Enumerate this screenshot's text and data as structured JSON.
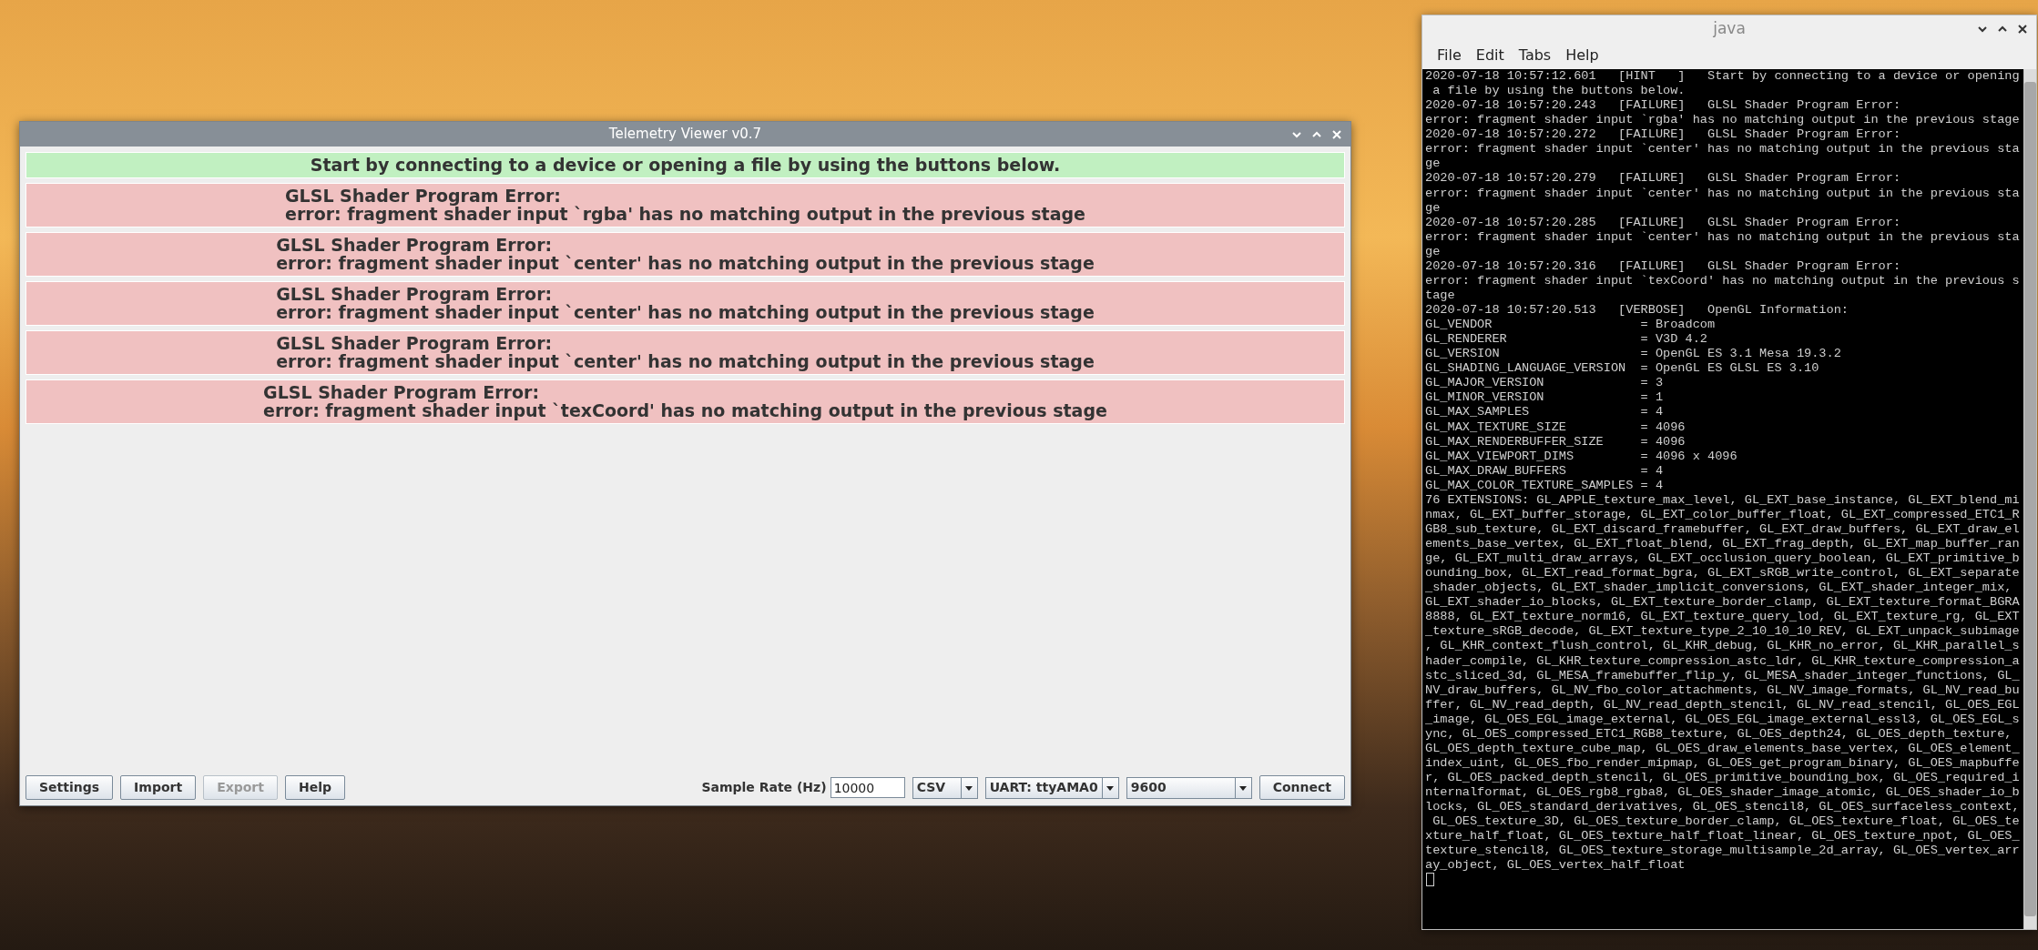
{
  "telemetry_window": {
    "title": "Telemetry Viewer v0.7",
    "messages": [
      {
        "kind": "hint",
        "lines": [
          "Start by connecting to a device or opening a file by using the buttons below."
        ]
      },
      {
        "kind": "failure",
        "lines": [
          "GLSL Shader Program Error:",
          "error: fragment shader input `rgba' has no matching output in the previous stage"
        ]
      },
      {
        "kind": "failure",
        "lines": [
          "GLSL Shader Program Error:",
          "error: fragment shader input `center' has no matching output in the previous stage"
        ]
      },
      {
        "kind": "failure",
        "lines": [
          "GLSL Shader Program Error:",
          "error: fragment shader input `center' has no matching output in the previous stage"
        ]
      },
      {
        "kind": "failure",
        "lines": [
          "GLSL Shader Program Error:",
          "error: fragment shader input `center' has no matching output in the previous stage"
        ]
      },
      {
        "kind": "failure",
        "lines": [
          "GLSL Shader Program Error:",
          "error: fragment shader input `texCoord' has no matching output in the previous stage"
        ]
      }
    ],
    "buttons": [
      {
        "label": "Settings",
        "disabled": false
      },
      {
        "label": "Import",
        "disabled": false
      },
      {
        "label": "Export",
        "disabled": true
      },
      {
        "label": "Help",
        "disabled": false
      }
    ],
    "sample_rate_label": "Sample Rate (Hz)",
    "sample_rate": "10000",
    "format": "CSV",
    "port": "UART: ttyAMA0",
    "baud": "9600",
    "connect": "Connect"
  },
  "terminal_window": {
    "title": "java",
    "menu": [
      "File",
      "Edit",
      "Tabs",
      "Help"
    ],
    "lines": [
      "2020-07-18 10:57:12.601   [HINT   ]   Start by connecting to a device or opening",
      " a file by using the buttons below.",
      "2020-07-18 10:57:20.243   [FAILURE]   GLSL Shader Program Error:",
      "error: fragment shader input `rgba' has no matching output in the previous stage",
      "2020-07-18 10:57:20.272   [FAILURE]   GLSL Shader Program Error:",
      "error: fragment shader input `center' has no matching output in the previous sta",
      "ge",
      "2020-07-18 10:57:20.279   [FAILURE]   GLSL Shader Program Error:",
      "error: fragment shader input `center' has no matching output in the previous sta",
      "ge",
      "2020-07-18 10:57:20.285   [FAILURE]   GLSL Shader Program Error:",
      "error: fragment shader input `center' has no matching output in the previous sta",
      "ge",
      "2020-07-18 10:57:20.316   [FAILURE]   GLSL Shader Program Error:",
      "error: fragment shader input `texCoord' has no matching output in the previous s",
      "tage",
      "2020-07-18 10:57:20.513   [VERBOSE]   OpenGL Information:",
      "GL_VENDOR                    = Broadcom",
      "GL_RENDERER                  = V3D 4.2",
      "GL_VERSION                   = OpenGL ES 3.1 Mesa 19.3.2",
      "GL_SHADING_LANGUAGE_VERSION  = OpenGL ES GLSL ES 3.10",
      "GL_MAJOR_VERSION             = 3",
      "GL_MINOR_VERSION             = 1",
      "GL_MAX_SAMPLES               = 4",
      "GL_MAX_TEXTURE_SIZE          = 4096",
      "GL_MAX_RENDERBUFFER_SIZE     = 4096",
      "GL_MAX_VIEWPORT_DIMS         = 4096 x 4096",
      "GL_MAX_DRAW_BUFFERS          = 4",
      "GL_MAX_COLOR_TEXTURE_SAMPLES = 4",
      "76 EXTENSIONS: GL_APPLE_texture_max_level, GL_EXT_base_instance, GL_EXT_blend_mi",
      "nmax, GL_EXT_buffer_storage, GL_EXT_color_buffer_float, GL_EXT_compressed_ETC1_R",
      "GB8_sub_texture, GL_EXT_discard_framebuffer, GL_EXT_draw_buffers, GL_EXT_draw_el",
      "ements_base_vertex, GL_EXT_float_blend, GL_EXT_frag_depth, GL_EXT_map_buffer_ran",
      "ge, GL_EXT_multi_draw_arrays, GL_EXT_occlusion_query_boolean, GL_EXT_primitive_b",
      "ounding_box, GL_EXT_read_format_bgra, GL_EXT_sRGB_write_control, GL_EXT_separate",
      "_shader_objects, GL_EXT_shader_implicit_conversions, GL_EXT_shader_integer_mix,",
      "GL_EXT_shader_io_blocks, GL_EXT_texture_border_clamp, GL_EXT_texture_format_BGRA",
      "8888, GL_EXT_texture_norm16, GL_EXT_texture_query_lod, GL_EXT_texture_rg, GL_EXT",
      "_texture_sRGB_decode, GL_EXT_texture_type_2_10_10_10_REV, GL_EXT_unpack_subimage",
      ", GL_KHR_context_flush_control, GL_KHR_debug, GL_KHR_no_error, GL_KHR_parallel_s",
      "hader_compile, GL_KHR_texture_compression_astc_ldr, GL_KHR_texture_compression_a",
      "stc_sliced_3d, GL_MESA_framebuffer_flip_y, GL_MESA_shader_integer_functions, GL_",
      "NV_draw_buffers, GL_NV_fbo_color_attachments, GL_NV_image_formats, GL_NV_read_bu",
      "ffer, GL_NV_read_depth, GL_NV_read_depth_stencil, GL_NV_read_stencil, GL_OES_EGL",
      "_image, GL_OES_EGL_image_external, GL_OES_EGL_image_external_essl3, GL_OES_EGL_s",
      "ync, GL_OES_compressed_ETC1_RGB8_texture, GL_OES_depth24, GL_OES_depth_texture,",
      "GL_OES_depth_texture_cube_map, GL_OES_draw_elements_base_vertex, GL_OES_element_",
      "index_uint, GL_OES_fbo_render_mipmap, GL_OES_get_program_binary, GL_OES_mapbuffe",
      "r, GL_OES_packed_depth_stencil, GL_OES_primitive_bounding_box, GL_OES_required_i",
      "nternalformat, GL_OES_rgb8_rgba8, GL_OES_shader_image_atomic, GL_OES_shader_io_b",
      "locks, GL_OES_standard_derivatives, GL_OES_stencil8, GL_OES_surfaceless_context,",
      " GL_OES_texture_3D, GL_OES_texture_border_clamp, GL_OES_texture_float, GL_OES_te",
      "xture_half_float, GL_OES_texture_half_float_linear, GL_OES_texture_npot, GL_OES_",
      "texture_stencil8, GL_OES_texture_storage_multisample_2d_array, GL_OES_vertex_arr",
      "ay_object, GL_OES_vertex_half_float"
    ]
  }
}
